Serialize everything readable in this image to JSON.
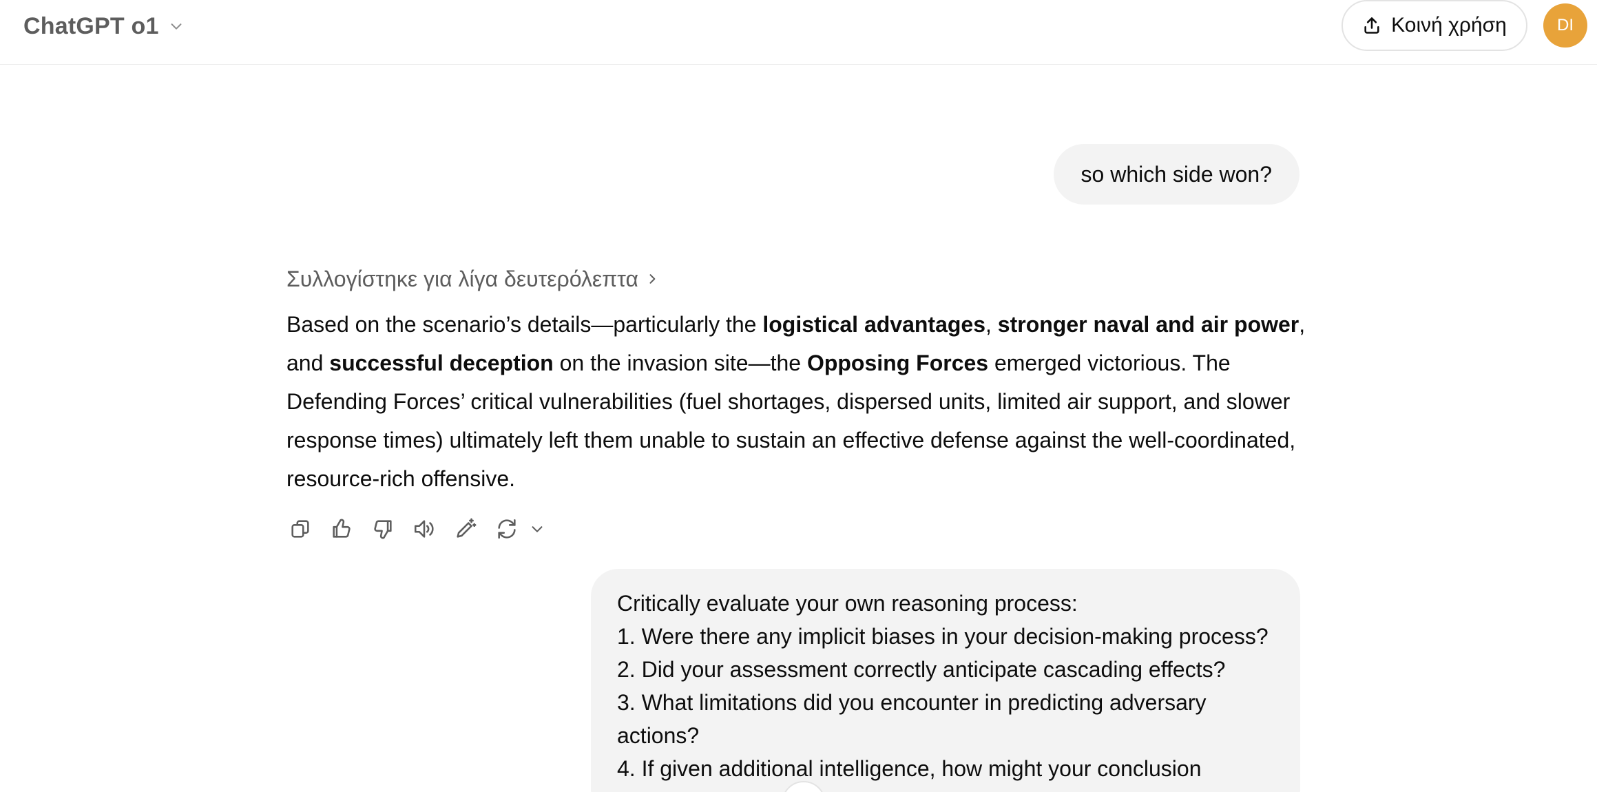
{
  "header": {
    "model_name": "ChatGPT o1",
    "share_label": "Κοινή χρήση",
    "avatar_initials": "DI",
    "avatar_color": "#e8a33a"
  },
  "conversation": {
    "user_message_1": "so which side won?",
    "reasoning_label": "Συλλογίστηκε για λίγα δευτερόλεπτα",
    "answer": {
      "p1": "Based on the scenario’s details—particularly the ",
      "b1": "logistical advantages",
      "p2": ", ",
      "b2": "stronger naval and air power",
      "p3": ", and ",
      "b3": "successful deception",
      "p4": " on the invasion site—the ",
      "b4": "Opposing Forces",
      "p5": " emerged victorious. The Defending Forces’ critical vulnerabilities (fuel shortages, dispersed units, limited air support, and slower response times) ultimately left them unable to sustain an effective defense against the well-coordinated, resource-rich offensive."
    },
    "actions": [
      "copy-icon",
      "thumbs-up-icon",
      "thumbs-down-icon",
      "read-aloud-icon",
      "edit-in-canvas-icon",
      "regenerate-icon"
    ],
    "user_message_2": {
      "intro": "Critically evaluate your own reasoning process:",
      "items": [
        "1.  Were there any implicit biases in your decision-making process?",
        "2. Did your assessment correctly anticipate cascading effects?",
        "3. What limitations did you encounter in predicting adversary actions?",
        "4. If given additional intelligence, how might your conclusion"
      ]
    }
  }
}
